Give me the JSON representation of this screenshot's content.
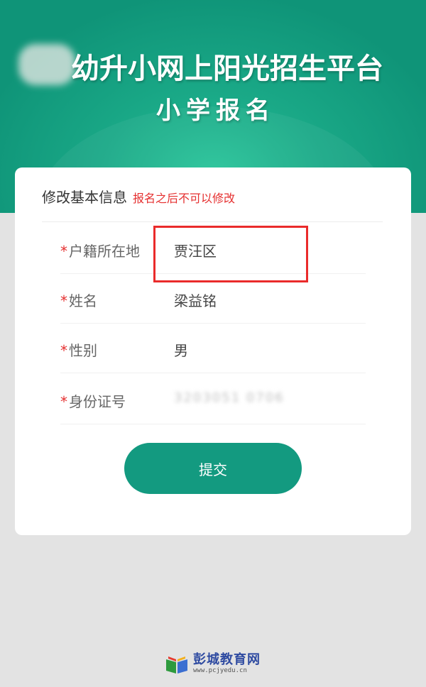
{
  "header": {
    "title": "幼升小网上阳光招生平台",
    "subtitle": "小学报名"
  },
  "card": {
    "title": "修改基本信息",
    "warning": "报名之后不可以修改",
    "required_mark": "*"
  },
  "form": {
    "rows": [
      {
        "label": "户籍所在地",
        "value": "贾汪区"
      },
      {
        "label": "姓名",
        "value": "梁益铭"
      },
      {
        "label": "性别",
        "value": "男"
      },
      {
        "label": "身份证号",
        "value": "3203051 0706"
      }
    ]
  },
  "actions": {
    "submit_label": "提交"
  },
  "watermark": {
    "name": "彭城教育网",
    "url": "www.pcjyedu.cn"
  },
  "colors": {
    "brand_green": "#139a80",
    "warning_red": "#e52f2f",
    "highlight_red": "#ea2b2b",
    "watermark_blue": "#2f4ba1"
  },
  "icons": {
    "watermark_logo": "book-icon"
  }
}
